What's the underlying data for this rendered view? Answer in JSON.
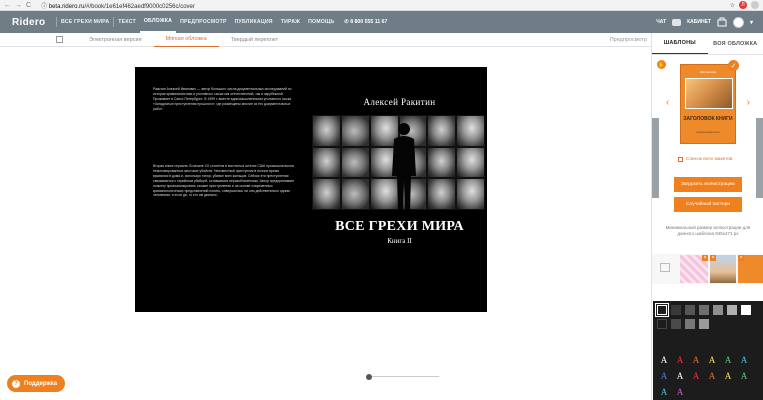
{
  "browser": {
    "back": "←",
    "forward": "→",
    "reload": "C",
    "lock": "ⓘ",
    "host": "beta.ridero.ru",
    "path": "/#/book/1e61ef462aedf9000c0256c/cover",
    "star": "☆",
    "avatar_letter": "Л"
  },
  "header": {
    "logo": "Ridero",
    "nav": [
      "ВСЕ ГРЕХИ МИРА",
      "ТЕКСТ",
      "ОБЛОЖКА",
      "ПРЕДПРОСМОТР",
      "ПУБЛИКАЦИЯ",
      "ТИРАЖ",
      "ПОМОЩЬ"
    ],
    "phone": "8 800 555 11 67",
    "chat": "ЧАТ",
    "cabinet": "КАБИНЕТ"
  },
  "subtoolbar": {
    "tabs": [
      "Электронная версия",
      "Мягкая обложка",
      "Твердый переплет"
    ],
    "preview": "Предпросмотр"
  },
  "cover": {
    "blurb1": "Ракитин Алексей Иванович — автор большого числа документальных исследований по истории криминалистики и уголовного сыска как отечественной, так и зарубежной. Проживает в Санкт-Петербурге. В 1999 г. вместе единомышленником уголовного сыска «Загадочные преступления прошлого», где размещены многие из его документальных работ.",
    "blurb2": "Вторая книга сериала. В начале XX столетия в восточных штатах США произошла волна немотивированных жестоких убийств. Неизвестный преступник в ночное время врывался в дома и, используя топор, убивал всех жильцов. Сейчас эти преступления связываются с серийным убийцей, оставшимся неразоблаченным. Автор предпринимает попытку проанализировать схожие преступления и на основе современных криминологических представлений понять, совершались ли они действительно одним человеком, и если да, то кто им двигало.",
    "author": "Алексей Ракитин",
    "title": "ВСЕ ГРЕХИ МИРА",
    "subtitle": "Книга II"
  },
  "support": {
    "label": "Поддержка"
  },
  "panel": {
    "tabs": [
      "ШАБЛОНЫ",
      "ВОЯ ОБЛОЖКА"
    ],
    "template": {
      "top": "Имя автора",
      "title": "ЗАГОЛОВОК КНИГИ",
      "sub": "подзаголовок книги"
    },
    "list_link": "Список всех макетов",
    "upload_button": "Загрузить иллюстрацию",
    "random_button": "Случайный паттерн",
    "hint": "Минимальный размер иллюстрации для данного шаблона 945х471 px"
  },
  "colors": {
    "accent": "#f07f1e",
    "header": "#6f7d86",
    "swatches": [
      "#1c1c1c",
      "#3a3a3a",
      "#555555",
      "#6e6e6e",
      "#8f8f8f",
      "#b0b0b0",
      "#ffffff",
      "#1c1c1c",
      "#4a4a4a",
      "#777777",
      "#999999"
    ],
    "letter_colors": [
      "#ffffff",
      "#e53935",
      "#e07030",
      "#f2e85a",
      "#5cd07a",
      "#4cc3e8",
      "#4a7fe0",
      "#d05ad0"
    ]
  }
}
